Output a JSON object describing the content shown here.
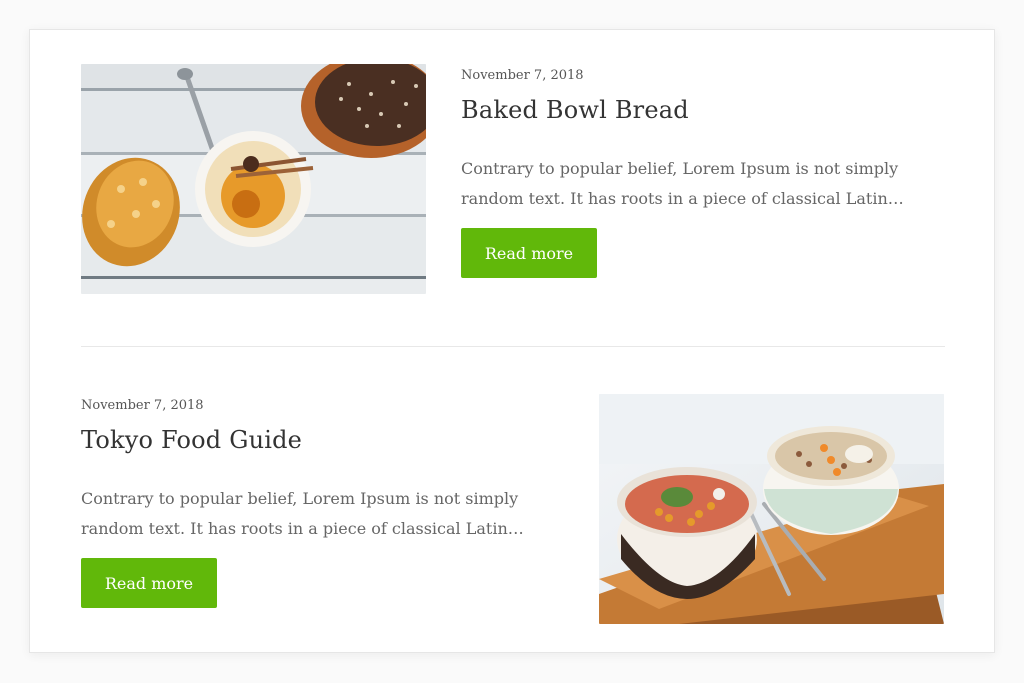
{
  "posts": [
    {
      "date": "November 7, 2018",
      "title": "Baked Bowl Bread",
      "excerpt": "Contrary to popular belief, Lorem Ipsum is not simply random text. It has roots in a piece of classical Latin…",
      "button_label": "Read more",
      "image_icon": "baked-bowl-bread-photo"
    },
    {
      "date": "November 7, 2018",
      "title": "Tokyo Food Guide",
      "excerpt": "Contrary to popular belief, Lorem Ipsum is not simply random text. It has roots in a piece of classical Latin…",
      "button_label": "Read more",
      "image_icon": "tokyo-food-bowls-photo"
    }
  ],
  "colors": {
    "button": "#61b80a",
    "divider": "#e8e8e8"
  }
}
